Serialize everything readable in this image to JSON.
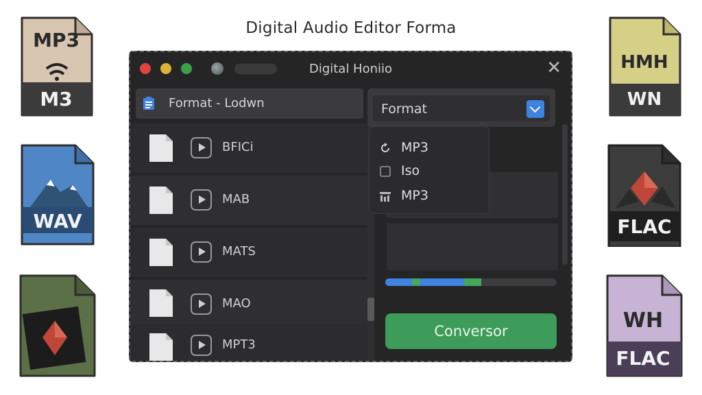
{
  "caption": "Digital Audio Editor Forma",
  "window": {
    "title": "Digital Honiio",
    "close_glyph": "✕",
    "colors": {
      "red": "#e0443e",
      "yellow": "#dcb334",
      "green": "#3aa04a",
      "accent": "#3f82e0",
      "convert": "#3e9c5a"
    }
  },
  "header": {
    "label": "Format - Lodwn",
    "icon": "document-icon"
  },
  "files": [
    {
      "name": "BFICi"
    },
    {
      "name": "MAB"
    },
    {
      "name": "MATS"
    },
    {
      "name": "MAO"
    },
    {
      "name": "MPT3"
    }
  ],
  "format_select": {
    "value": "Format",
    "icon": "chevron-down-icon"
  },
  "format_menu": [
    {
      "label": "MP3",
      "icon": "refresh-icon"
    },
    {
      "label": "Iso",
      "icon": "checkbox-icon"
    },
    {
      "label": "MP3",
      "icon": "equalizer-icon"
    }
  ],
  "progress": {
    "value": 0.56
  },
  "convert_button": "Conversor",
  "side_icons": {
    "left": [
      {
        "top": "MP3",
        "band": "M3",
        "color": "#d9c6b0"
      },
      {
        "top": "",
        "band": "WAV",
        "color": "#4f86c6"
      },
      {
        "top": "",
        "band": "",
        "color": "#5c7048"
      }
    ],
    "right": [
      {
        "top": "HMH",
        "band": "WN",
        "color": "#d6cf86"
      },
      {
        "top": "",
        "band": "FLAC",
        "color": "#3c3c3c"
      },
      {
        "top": "WH",
        "band": "FLAC",
        "color": "#c7b3d3"
      }
    ]
  }
}
